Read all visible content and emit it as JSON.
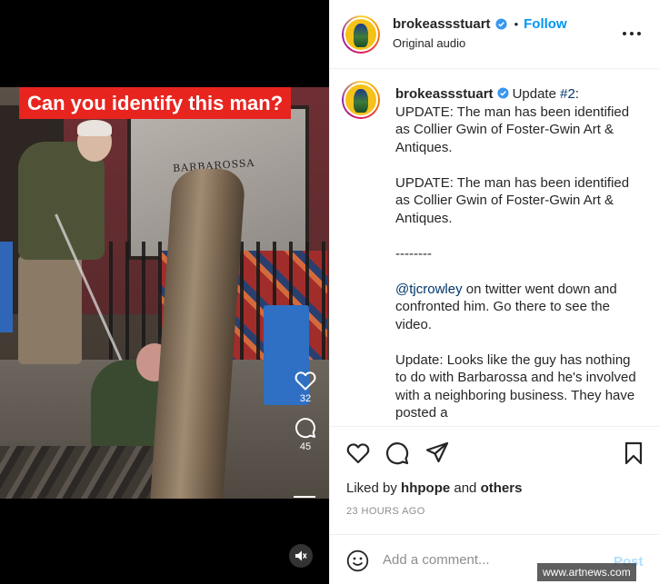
{
  "header": {
    "username": "brokeassstuart",
    "follow_label": "Follow",
    "separator": "•",
    "audio_label": "Original audio"
  },
  "media": {
    "banner_text": "Can you identify this man?",
    "like_count": "32",
    "comment_count": "45",
    "storefront_sign": "BARBAROSSA"
  },
  "caption": {
    "username": "brokeassstuart",
    "prefix": "Update ",
    "hashtag": "#2",
    "after_hashtag": ":",
    "line1": "UPDATE: The man has been identified as Collier Gwin of Foster-Gwin Art & Antiques.",
    "paragraph2": "UPDATE: The man has been identified as Collier Gwin of Foster-Gwin Art & Antiques.",
    "separator": "--------",
    "mention": "@tjcrowley",
    "mention_rest": " on twitter went down and confronted him. Go there to see the video.",
    "paragraph4": "Update: Looks like the guy has nothing to do with Barbarossa and he's involved with a neighboring business. They have posted a"
  },
  "likes": {
    "prefix": "Liked by ",
    "user": "hhpope",
    "middle": " and ",
    "others": "others"
  },
  "timestamp": "23 HOURS AGO",
  "comment": {
    "placeholder": "Add a comment...",
    "post_label": "Post"
  },
  "watermark": "www.artnews.com",
  "colors": {
    "link_blue": "#0095f6",
    "verified_blue": "#3897f0",
    "banner_red": "#e8241f",
    "post_disabled": "#b2dffc"
  },
  "icons": {
    "heart": "heart-icon",
    "comment": "comment-icon",
    "share": "paper-plane-icon",
    "save": "bookmark-icon",
    "more": "more-options-icon",
    "mute": "muted-speaker-icon",
    "emoji": "emoji-icon"
  }
}
